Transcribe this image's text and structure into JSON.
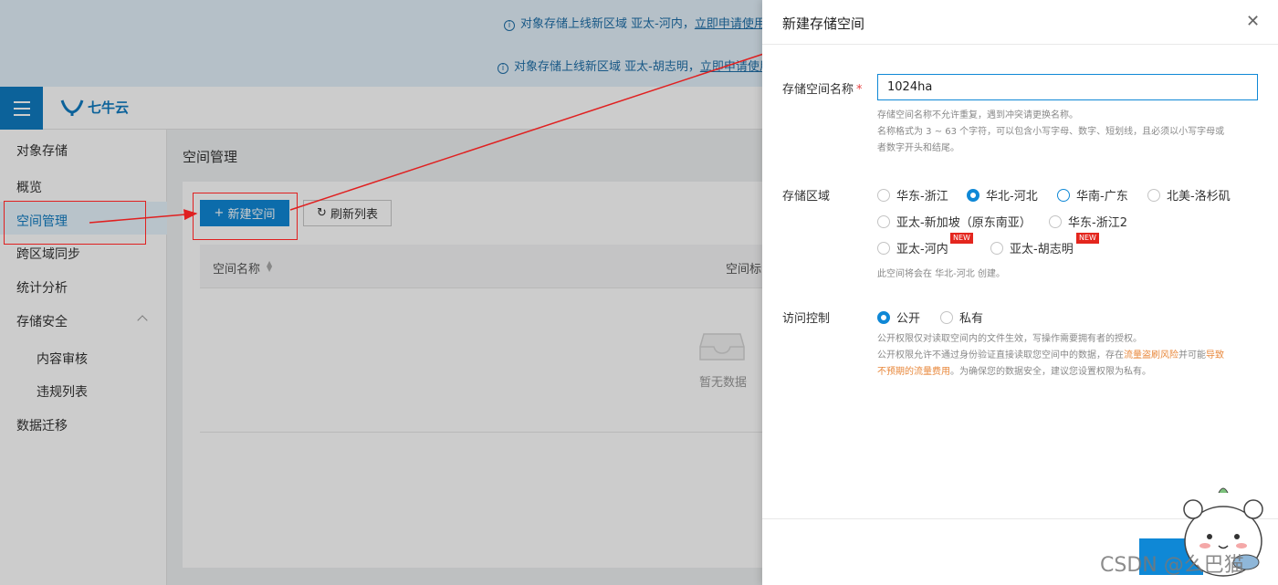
{
  "banner": {
    "line1_prefix": "对象存储上线新区域 亚太-河内，",
    "line1_link": "立即申请使用",
    "line2_prefix": "对象存储上线新区域 亚太-胡志明，",
    "line2_link": "立即申请使用"
  },
  "header": {
    "logo_text": "七牛云"
  },
  "sidebar": {
    "items": [
      "对象存储",
      "概览",
      "空间管理",
      "跨区域同步",
      "统计分析",
      "存储安全",
      "内容审核",
      "违规列表",
      "数据迁移"
    ]
  },
  "main": {
    "title": "空间管理",
    "new_button": "新建空间",
    "refresh_button": "刷新列表",
    "table_columns": [
      "空间名称",
      "空间标"
    ],
    "empty_text": "暂无数据"
  },
  "drawer": {
    "title": "新建存储空间",
    "name_label": "存储空间名称",
    "name_required": "*",
    "name_value": "1024ha",
    "name_hints": [
      "存储空间名称不允许重复，遇到冲突请更换名称。",
      "名称格式为 3 ~ 63 个字符，可以包含小写字母、数字、短划线，且必须以小写字母或",
      "者数字开头和结尾。"
    ],
    "region_label": "存储区域",
    "regions": [
      "华东-浙江",
      "华北-河北",
      "华南-广东",
      "北美-洛杉矶",
      "亚太-新加坡（原东南亚）",
      "华东-浙江2",
      "亚太-河内",
      "亚太-胡志明"
    ],
    "new_badge": "NEW",
    "region_hint": "此空间将会在 华北-河北 创建。",
    "access_label": "访问控制",
    "access_options": [
      "公开",
      "私有"
    ],
    "access_hint_1": "公开权限仅对读取空间内的文件生效，写操作需要拥有者的授权。",
    "access_hint_2a": "公开权限允许不通过身份验证直接读取您空间中的数据，存在",
    "access_hint_2b": "流量盗刷风险",
    "access_hint_2c": "并可能",
    "access_hint_2d": "导致",
    "access_hint_3a": "不预期的流量费用",
    "access_hint_3b": "。为确保您的数据安全，建议您设置权限为私有。"
  },
  "watermark": "CSDN @么巴猫",
  "colors": {
    "primary": "#0f88d6",
    "annotation": "#e02020",
    "warning": "#e8873a"
  }
}
